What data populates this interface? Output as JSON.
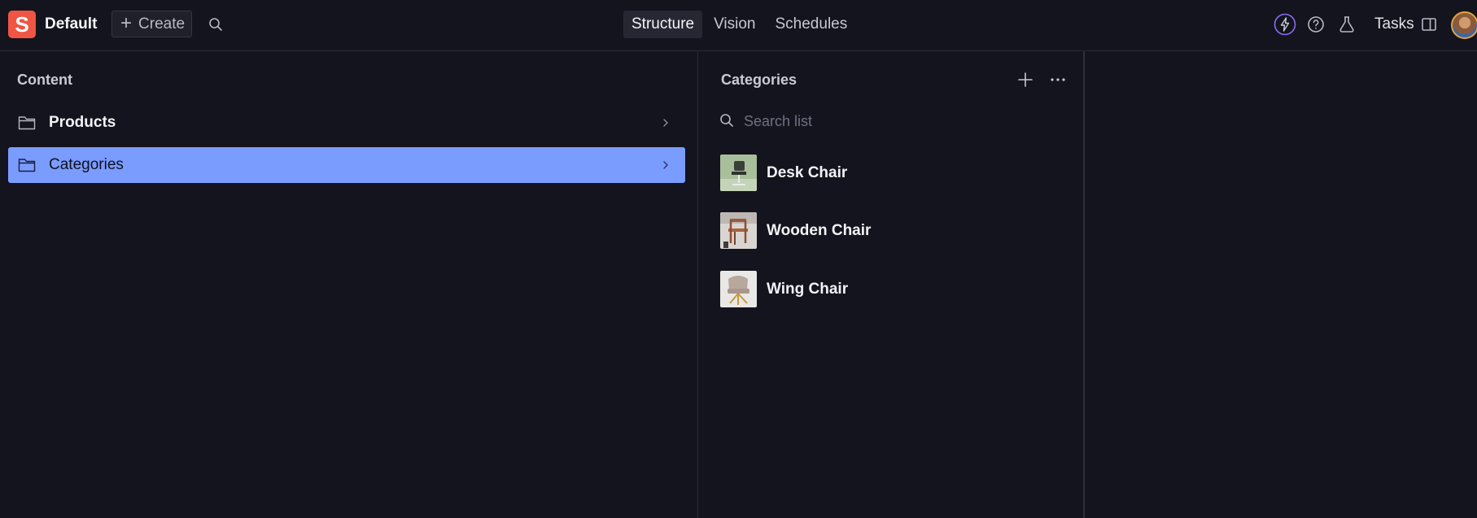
{
  "topbar": {
    "logo_letter": "S",
    "workspace": "Default",
    "create_label": "Create",
    "nav": [
      {
        "label": "Structure",
        "active": true
      },
      {
        "label": "Vision",
        "active": false
      },
      {
        "label": "Schedules",
        "active": false
      }
    ],
    "tasks_label": "Tasks"
  },
  "content_pane": {
    "title": "Content",
    "items": [
      {
        "label": "Products",
        "selected": false,
        "icon": "folder-icon"
      },
      {
        "label": "Categories",
        "selected": true,
        "icon": "folder-icon"
      }
    ]
  },
  "categories_pane": {
    "title": "Categories",
    "search_placeholder": "Search list",
    "items": [
      {
        "label": "Desk Chair"
      },
      {
        "label": "Wooden Chair"
      },
      {
        "label": "Wing Chair"
      }
    ]
  },
  "colors": {
    "background": "#13141d",
    "selected": "#7b9cff",
    "brand": "#f05543",
    "accent_ring": "#8b6cf0"
  }
}
